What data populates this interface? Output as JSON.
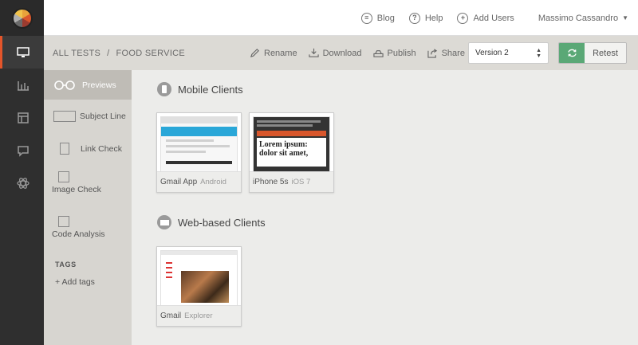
{
  "topbar": {
    "blog": "Blog",
    "help": "Help",
    "add_users": "Add Users",
    "user": "Massimo Cassandro"
  },
  "breadcrumb": {
    "root": "ALL TESTS",
    "sep": "/",
    "current": "FOOD SERVICE"
  },
  "actions": {
    "rename": "Rename",
    "download": "Download",
    "publish": "Publish",
    "share": "Share",
    "version": "Version 2",
    "retest": "Retest"
  },
  "panel": {
    "previews": "Previews",
    "subject_line": "Subject Line",
    "link_check": "Link Check",
    "image_check": "Image Check",
    "code_analysis": "Code Analysis",
    "tags_title": "TAGS",
    "add_tags": "+ Add tags"
  },
  "sections": {
    "mobile": "Mobile Clients",
    "web": "Web-based Clients"
  },
  "cards": [
    {
      "name": "Gmail App",
      "os": "Android"
    },
    {
      "name": "iPhone 5s",
      "os": "iOS 7",
      "preview_text": "Lorem ipsum: dolor sit amet,"
    },
    {
      "name": "Gmail",
      "os": "Explorer"
    }
  ],
  "colors": {
    "accent": "#e4552a",
    "retest_green": "#5aa876"
  }
}
